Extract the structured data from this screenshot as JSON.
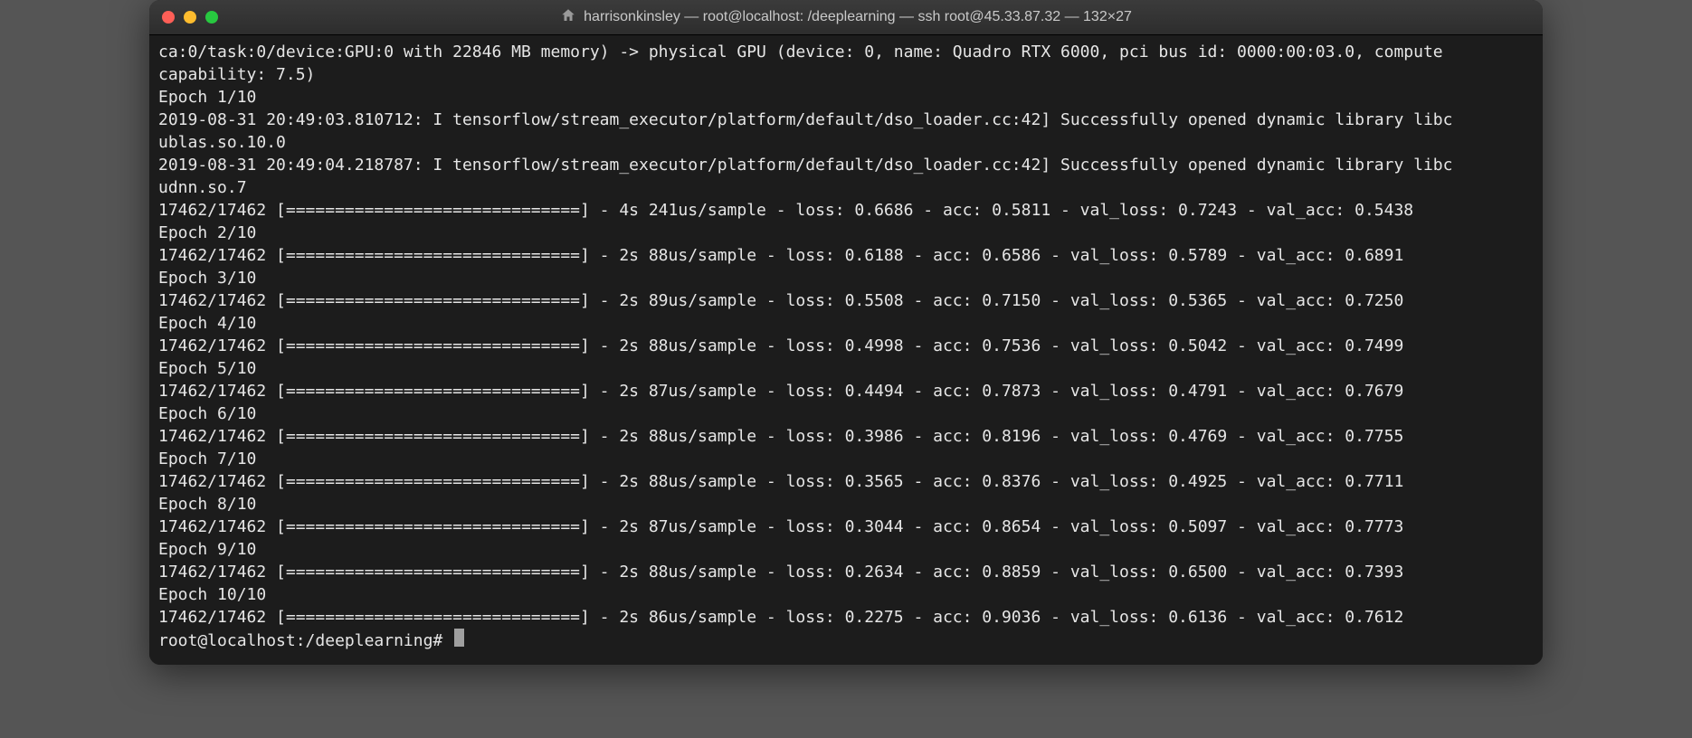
{
  "window": {
    "title": "harrisonkinsley — root@localhost: /deeplearning — ssh root@45.33.87.32 — 132×27"
  },
  "gpu_line": "ca:0/task:0/device:GPU:0 with 22846 MB memory) -> physical GPU (device: 0, name: Quadro RTX 6000, pci bus id: 0000:00:03.0, compute",
  "gpu_line2": "capability: 7.5)",
  "log1a": "2019-08-31 20:49:03.810712: I tensorflow/stream_executor/platform/default/dso_loader.cc:42] Successfully opened dynamic library libc",
  "log1b": "ublas.so.10.0",
  "log2a": "2019-08-31 20:49:04.218787: I tensorflow/stream_executor/platform/default/dso_loader.cc:42] Successfully opened dynamic library libc",
  "log2b": "udnn.so.7",
  "epoch_label": {
    "e1": "Epoch 1/10",
    "e2": "Epoch 2/10",
    "e3": "Epoch 3/10",
    "e4": "Epoch 4/10",
    "e5": "Epoch 5/10",
    "e6": "Epoch 6/10",
    "e7": "Epoch 7/10",
    "e8": "Epoch 8/10",
    "e9": "Epoch 9/10",
    "e10": "Epoch 10/10"
  },
  "progress": {
    "p1": "17462/17462 [==============================] - 4s 241us/sample - loss: 0.6686 - acc: 0.5811 - val_loss: 0.7243 - val_acc: 0.5438",
    "p2": "17462/17462 [==============================] - 2s 88us/sample - loss: 0.6188 - acc: 0.6586 - val_loss: 0.5789 - val_acc: 0.6891",
    "p3": "17462/17462 [==============================] - 2s 89us/sample - loss: 0.5508 - acc: 0.7150 - val_loss: 0.5365 - val_acc: 0.7250",
    "p4": "17462/17462 [==============================] - 2s 88us/sample - loss: 0.4998 - acc: 0.7536 - val_loss: 0.5042 - val_acc: 0.7499",
    "p5": "17462/17462 [==============================] - 2s 87us/sample - loss: 0.4494 - acc: 0.7873 - val_loss: 0.4791 - val_acc: 0.7679",
    "p6": "17462/17462 [==============================] - 2s 88us/sample - loss: 0.3986 - acc: 0.8196 - val_loss: 0.4769 - val_acc: 0.7755",
    "p7": "17462/17462 [==============================] - 2s 88us/sample - loss: 0.3565 - acc: 0.8376 - val_loss: 0.4925 - val_acc: 0.7711",
    "p8": "17462/17462 [==============================] - 2s 87us/sample - loss: 0.3044 - acc: 0.8654 - val_loss: 0.5097 - val_acc: 0.7773",
    "p9": "17462/17462 [==============================] - 2s 88us/sample - loss: 0.2634 - acc: 0.8859 - val_loss: 0.6500 - val_acc: 0.7393",
    "p10": "17462/17462 [==============================] - 2s 86us/sample - loss: 0.2275 - acc: 0.9036 - val_loss: 0.6136 - val_acc: 0.7612"
  },
  "prompt": "root@localhost:/deeplearning# "
}
